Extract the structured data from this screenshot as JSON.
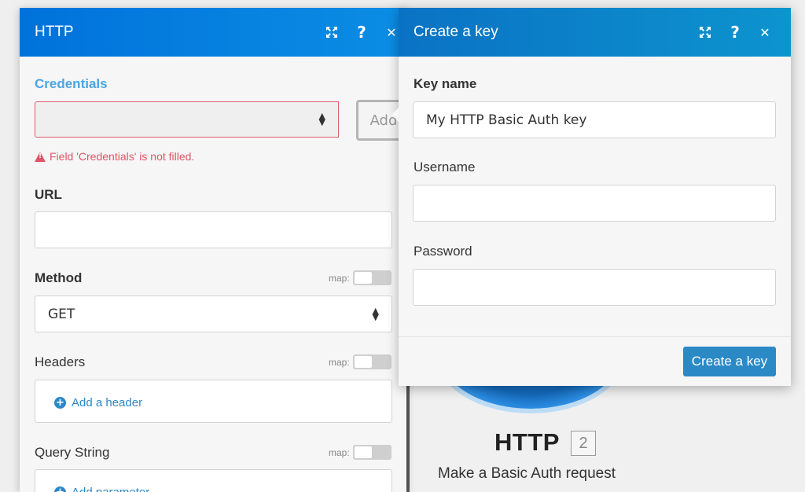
{
  "http_panel": {
    "title": "HTTP",
    "credentials_label": "Credentials",
    "credentials_value": "",
    "add_button": "Add",
    "error_text": "Field 'Credentials' is not filled.",
    "url_label": "URL",
    "url_value": "",
    "method_label": "Method",
    "method_value": "GET",
    "map_label": "map:",
    "headers_label": "Headers",
    "add_header": "Add a header",
    "query_label": "Query String",
    "add_parameter": "Add parameter"
  },
  "key_panel": {
    "title": "Create a key",
    "key_name_label": "Key name",
    "key_name_value": "My HTTP Basic Auth key",
    "username_label": "Username",
    "username_value": "",
    "password_label": "Password",
    "password_value": "",
    "create_button": "Create a key"
  },
  "module": {
    "title": "HTTP",
    "badge": "2",
    "subtitle": "Make a Basic Auth request"
  },
  "colors": {
    "header_blue": "#0072db",
    "error_red": "#e05565",
    "link_blue": "#2b88c8"
  },
  "icons": {
    "header_maximize": "expand-icon",
    "header_help": "help-icon",
    "header_close": "close-icon"
  }
}
